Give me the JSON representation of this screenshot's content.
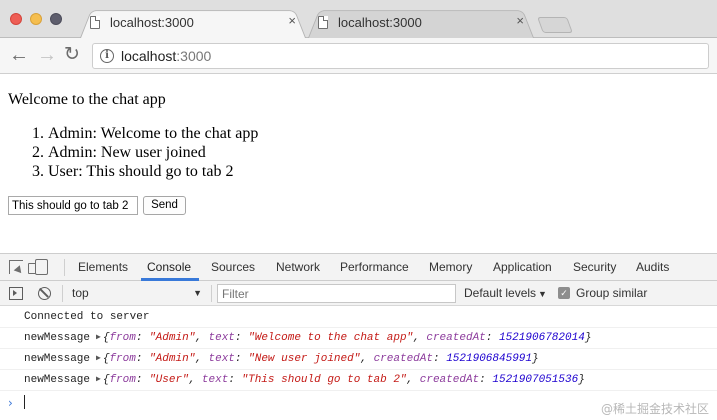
{
  "window": {
    "tabs": [
      {
        "title": "localhost:3000",
        "close": "×",
        "active": true
      },
      {
        "title": "localhost:3000",
        "close": "×",
        "active": false
      }
    ]
  },
  "toolbar": {
    "back": "←",
    "forward": "→",
    "reload": "↻",
    "info": "i",
    "url_host": "localhost",
    "url_port": ":3000"
  },
  "page": {
    "heading": "Welcome to the chat app",
    "messages": [
      "Admin: Welcome to the chat app",
      "Admin: New user joined",
      "User: This should go to tab 2"
    ],
    "input_value": "This should go to tab 2",
    "send_label": "Send"
  },
  "devtools": {
    "tabs": [
      "Elements",
      "Console",
      "Sources",
      "Network",
      "Performance",
      "Memory",
      "Application",
      "Security",
      "Audits"
    ],
    "active_tab": "Console",
    "context": "top",
    "filter_placeholder": "Filter",
    "levels_label": "Default levels",
    "group_similar_label": "Group similar",
    "group_similar_checked": true,
    "console": {
      "plain_line": "Connected to server",
      "label": "newMessage",
      "entries": [
        {
          "from": "Admin",
          "text": "Welcome to the chat app",
          "createdAt": "1521906782014"
        },
        {
          "from": "Admin",
          "text": "New user joined",
          "createdAt": "1521906845991"
        },
        {
          "from": "User",
          "text": "This should go to tab 2",
          "createdAt": "1521907051536"
        }
      ],
      "key_from": "from",
      "key_text": "text",
      "key_created": "createdAt",
      "prompt": "›"
    }
  },
  "watermark": "@稀土掘金技术社区",
  "colors": {
    "accent": "#3879d9",
    "string": "#c41a16",
    "number": "#1c00cf",
    "key": "#8c3b9c"
  }
}
